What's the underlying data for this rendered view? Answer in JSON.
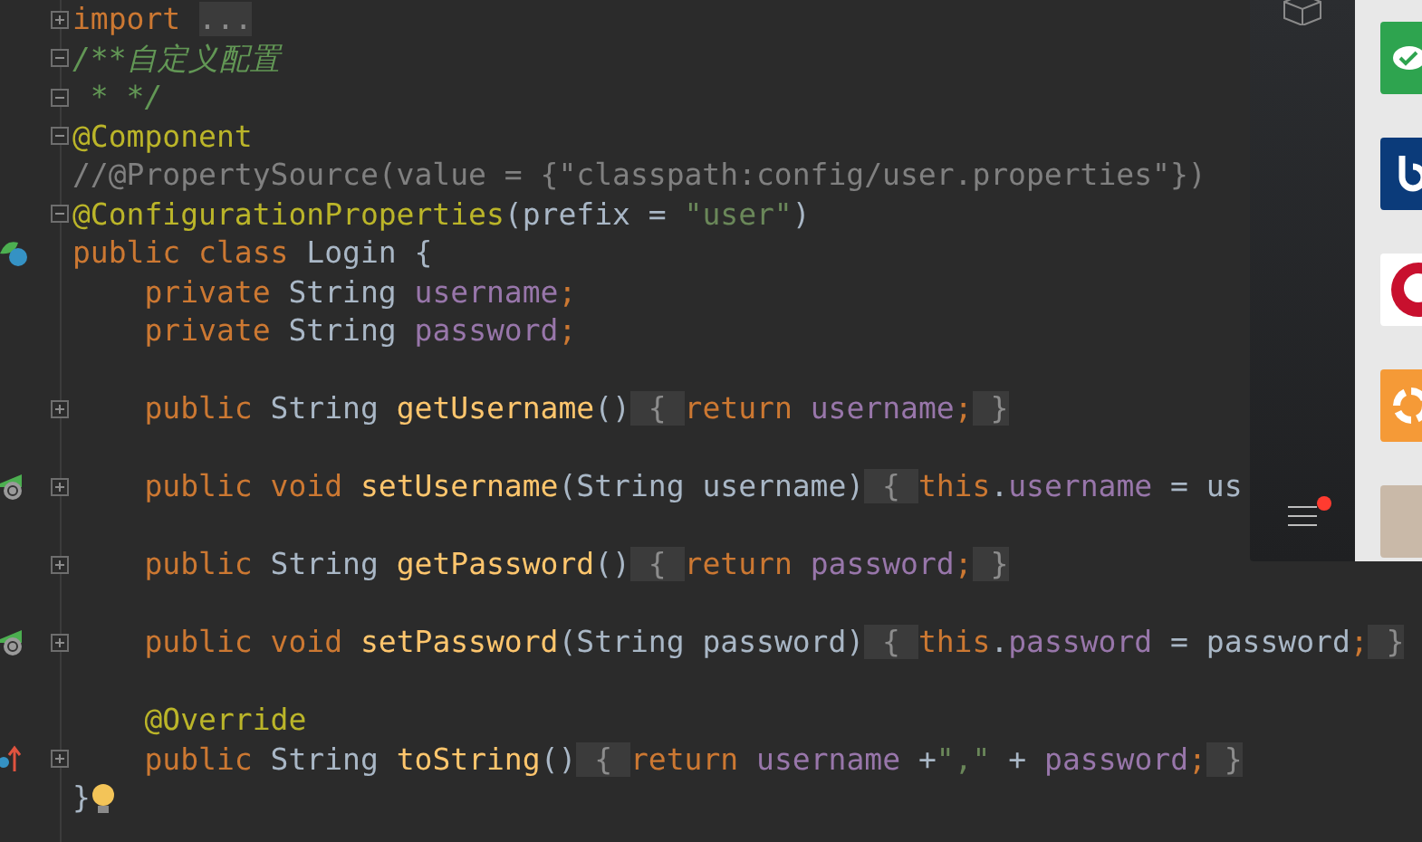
{
  "editor": {
    "lines": [
      {
        "fold_box": {
          "collapsed": true
        },
        "tokens": [
          {
            "kind": "keyword",
            "text": "import"
          },
          {
            "kind": "folded",
            "spaced": true,
            "text": "..."
          }
        ]
      },
      {
        "fold_box": {
          "collapsed": false
        },
        "tokens": [
          {
            "kind": "doc",
            "text": "/**自定义配置"
          }
        ]
      },
      {
        "fold_box": {
          "collapsed": false
        },
        "tokens": [
          {
            "kind": "doc",
            "text": " * */"
          }
        ]
      },
      {
        "fold_box": {
          "collapsed": false
        },
        "tokens": [
          {
            "kind": "annotation",
            "text": "@Component"
          }
        ]
      },
      {
        "tokens": [
          {
            "kind": "comment",
            "text": "//@PropertySource(value = {\"classpath:config/user.properties\"})"
          }
        ]
      },
      {
        "fold_box": {
          "collapsed": false
        },
        "tokens": [
          {
            "kind": "annotation",
            "text": "@ConfigurationProperties"
          },
          {
            "kind": "plain",
            "text": "(prefix = "
          },
          {
            "kind": "string",
            "text": "\"user\""
          },
          {
            "kind": "plain",
            "text": ")"
          }
        ]
      },
      {
        "gutter_icon": {
          "kind": "class"
        },
        "tokens": [
          {
            "kind": "keyword",
            "text": "public class "
          },
          {
            "kind": "plain",
            "text": "Login {"
          }
        ]
      },
      {
        "tokens": [
          {
            "kind": "keyword",
            "text": "    private "
          },
          {
            "kind": "plain",
            "text": "String "
          },
          {
            "kind": "field",
            "text": "username"
          },
          {
            "kind": "keyword",
            "text": ";"
          }
        ]
      },
      {
        "tokens": [
          {
            "kind": "keyword",
            "text": "    private "
          },
          {
            "kind": "plain",
            "text": "String "
          },
          {
            "kind": "field",
            "text": "password"
          },
          {
            "kind": "keyword",
            "text": ";"
          }
        ]
      },
      {
        "blank_before": true,
        "fold_box": {
          "collapsed": true
        },
        "tokens": [
          {
            "kind": "keyword",
            "text": "    public "
          },
          {
            "kind": "plain",
            "text": "String "
          },
          {
            "kind": "method",
            "text": "getUsername"
          },
          {
            "kind": "plain",
            "text": "()"
          },
          {
            "kind": "folded",
            "text": " { "
          },
          {
            "kind": "keyword",
            "text": "return "
          },
          {
            "kind": "field",
            "text": "username"
          },
          {
            "kind": "keyword",
            "text": ";"
          },
          {
            "kind": "folded",
            "text": " }"
          }
        ]
      },
      {
        "blank_before": true,
        "fold_box": {
          "collapsed": true
        },
        "gutter_icon": {
          "kind": "bean"
        },
        "tokens": [
          {
            "kind": "keyword",
            "text": "    public void "
          },
          {
            "kind": "method",
            "text": "setUsername"
          },
          {
            "kind": "plain",
            "text": "(String username)"
          },
          {
            "kind": "folded",
            "text": " { "
          },
          {
            "kind": "keyword",
            "text": "this"
          },
          {
            "kind": "plain",
            "text": "."
          },
          {
            "kind": "field",
            "text": "username"
          },
          {
            "kind": "plain",
            "text": " = us"
          }
        ]
      },
      {
        "blank_before": true,
        "fold_box": {
          "collapsed": true
        },
        "tokens": [
          {
            "kind": "keyword",
            "text": "    public "
          },
          {
            "kind": "plain",
            "text": "String "
          },
          {
            "kind": "method",
            "text": "getPassword"
          },
          {
            "kind": "plain",
            "text": "()"
          },
          {
            "kind": "folded",
            "text": " { "
          },
          {
            "kind": "keyword",
            "text": "return "
          },
          {
            "kind": "field",
            "text": "password"
          },
          {
            "kind": "keyword",
            "text": ";"
          },
          {
            "kind": "folded",
            "text": " }"
          }
        ]
      },
      {
        "blank_before": true,
        "fold_box": {
          "collapsed": true
        },
        "gutter_icon": {
          "kind": "bean"
        },
        "tokens": [
          {
            "kind": "keyword",
            "text": "    public void "
          },
          {
            "kind": "method",
            "text": "setPassword"
          },
          {
            "kind": "plain",
            "text": "(String password)"
          },
          {
            "kind": "folded",
            "text": " { "
          },
          {
            "kind": "keyword",
            "text": "this"
          },
          {
            "kind": "plain",
            "text": "."
          },
          {
            "kind": "field",
            "text": "password"
          },
          {
            "kind": "plain",
            "text": " = password"
          },
          {
            "kind": "keyword",
            "text": ";"
          },
          {
            "kind": "folded",
            "text": " }"
          }
        ]
      },
      {
        "blank_before": true,
        "tokens": [
          {
            "kind": "annotation",
            "text": "    @Override"
          }
        ]
      },
      {
        "fold_box": {
          "collapsed": true
        },
        "gutter_icon": {
          "kind": "override"
        },
        "tokens": [
          {
            "kind": "keyword",
            "text": "    public "
          },
          {
            "kind": "plain",
            "text": "String "
          },
          {
            "kind": "method",
            "text": "toString"
          },
          {
            "kind": "plain",
            "text": "()"
          },
          {
            "kind": "folded",
            "text": " { "
          },
          {
            "kind": "keyword",
            "text": "return "
          },
          {
            "kind": "field",
            "text": "username"
          },
          {
            "kind": "plain",
            "text": " +"
          },
          {
            "kind": "string",
            "text": "\",\""
          },
          {
            "kind": "plain",
            "text": " + "
          },
          {
            "kind": "field",
            "text": "password"
          },
          {
            "kind": "keyword",
            "text": ";"
          },
          {
            "kind": "folded",
            "text": " }"
          }
        ]
      },
      {
        "bulb": true,
        "tokens": [
          {
            "kind": "plain",
            "text": "}"
          }
        ]
      }
    ]
  },
  "dock": {
    "notification": true,
    "apps": [
      {
        "kind": "chat",
        "color": "#2ea44f"
      },
      {
        "kind": "letter",
        "color": "#0b3b7a"
      },
      {
        "kind": "portrait",
        "color": "#c8102e"
      },
      {
        "kind": "target",
        "color": "#f59a37"
      },
      {
        "kind": "photos",
        "color": "#c9b9a8"
      }
    ]
  }
}
